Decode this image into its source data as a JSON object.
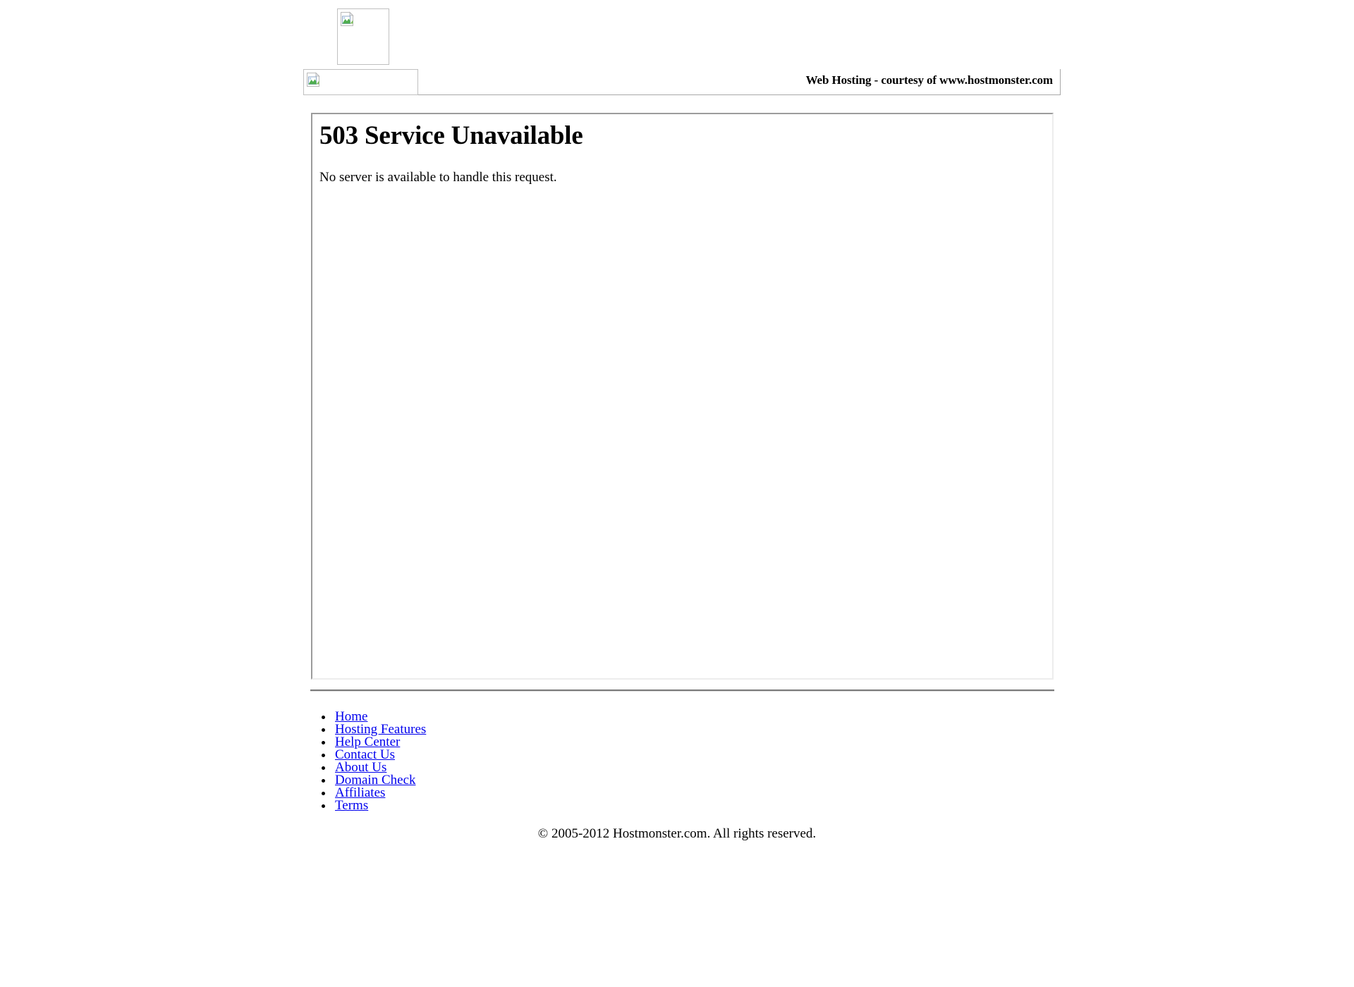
{
  "page": {
    "title": "503 Service Unavailable",
    "background_color": "#ffffff",
    "text_color": "#000000",
    "link_color": "#0000ee",
    "border_color": "#9c9c9c"
  },
  "header": {
    "logo_image": {
      "icon": "broken-image-icon",
      "alt": ""
    },
    "banner_image": {
      "icon": "broken-image-icon",
      "alt": ""
    },
    "tagline": "Web Hosting - courtesy of www.hostmonster.com"
  },
  "main": {
    "error_code": "503",
    "error_title": "503 Service Unavailable",
    "error_message": "No server is available to handle this request."
  },
  "footer": {
    "links": [
      {
        "label": "Home"
      },
      {
        "label": "Hosting Features"
      },
      {
        "label": "Help Center"
      },
      {
        "label": "Contact Us"
      },
      {
        "label": "About Us"
      },
      {
        "label": "Domain Check"
      },
      {
        "label": "Affiliates"
      },
      {
        "label": "Terms"
      }
    ],
    "copyright": "© 2005-2012 Hostmonster.com. All rights reserved."
  }
}
